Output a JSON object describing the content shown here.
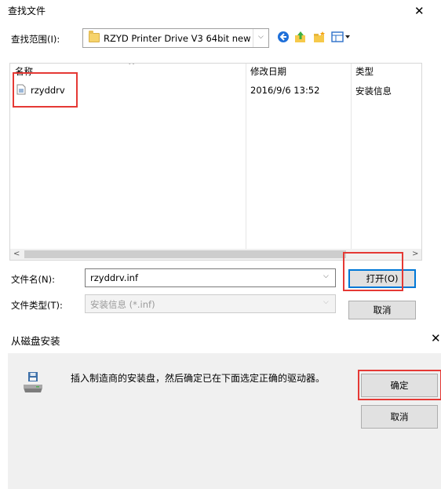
{
  "open_dialog": {
    "title": "查找文件",
    "close_glyph": "✕",
    "look_in": {
      "label": "查找范围(I):",
      "value": "RZYD Printer Drive V3 64bit new",
      "arrow": "⌵"
    },
    "toolbar": {
      "icons": [
        "back-icon",
        "up-folder-icon",
        "new-folder-icon",
        "view-menu-icon"
      ]
    },
    "file_list": {
      "columns": {
        "name": "名称",
        "modified": "修改日期",
        "type": "类型"
      },
      "sort_indicator": "^",
      "rows": [
        {
          "name": "rzyddrv",
          "modified": "2016/9/6 13:52",
          "type": "安装信息"
        }
      ],
      "scroll_left": "<",
      "scroll_right": ">"
    },
    "filename": {
      "label": "文件名(N):",
      "value": "rzyddrv.inf",
      "arrow": "⌵"
    },
    "filetype": {
      "label": "文件类型(T):",
      "value": "安装信息 (*.inf)",
      "arrow": "⌵"
    },
    "buttons": {
      "open": "打开(O)",
      "cancel": "取消"
    },
    "highlight_color": "#e53935",
    "accent_color": "#0078d7"
  },
  "install_dialog": {
    "title": "从磁盘安装",
    "close_glyph": "✕",
    "message": "插入制造商的安装盘，然后确定已在下面选定正确的驱动器。",
    "buttons": {
      "ok": "确定",
      "cancel": "取消"
    },
    "icon": "floppy-disk-drive-icon"
  }
}
